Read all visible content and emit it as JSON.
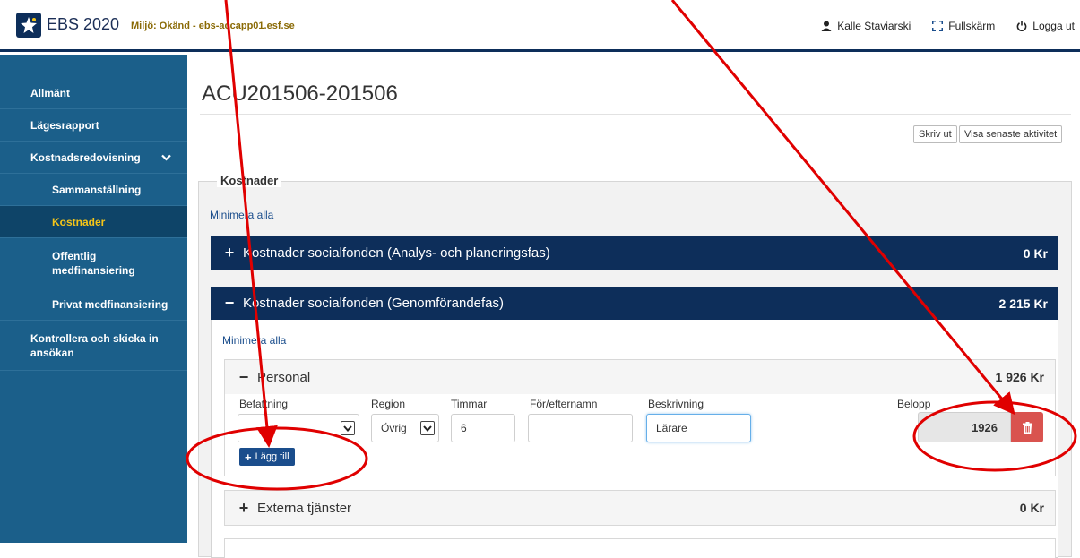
{
  "header": {
    "app_title": "EBS 2020",
    "env_label": "Miljö: Okänd - ebs-accapp01.esf.se",
    "user_name": "Kalle Staviarski",
    "fullscreen_label": "Fullskärm",
    "logout_label": "Logga ut"
  },
  "sidebar": {
    "items": [
      {
        "label": "Allmänt"
      },
      {
        "label": "Lägesrapport"
      },
      {
        "label": "Kostnadsredovisning"
      },
      {
        "label": "Sammanställning"
      },
      {
        "label": "Kostnader"
      },
      {
        "label": "Offentlig medfinansiering"
      },
      {
        "label": "Privat medfinansiering"
      },
      {
        "label": "Kontrollera och skicka in ansökan"
      }
    ]
  },
  "main": {
    "page_title": "ACU201506-201506",
    "print_label": "Skriv ut",
    "latest_activity_label": "Visa senaste aktivitet",
    "section_title": "Kostnader",
    "minimize_all_label": "Minimera alla",
    "panels": [
      {
        "title": "Kostnader socialfonden (Analys- och planeringsfas)",
        "sum": "0 Kr",
        "toggle": "+"
      },
      {
        "title": "Kostnader socialfonden (Genomförandefas)",
        "sum": "2 215 Kr",
        "toggle": "−"
      }
    ],
    "sub_panels": [
      {
        "title": "Personal",
        "sum": "1 926 Kr",
        "toggle": "−"
      },
      {
        "title": "Externa tjänster",
        "sum": "0 Kr",
        "toggle": "+"
      }
    ],
    "personal_form": {
      "labels": {
        "position": "Befattning",
        "region": "Region",
        "hours": "Timmar",
        "name": "För/efternamn",
        "description": "Beskrivning",
        "amount": "Belopp"
      },
      "values": {
        "position": "",
        "region": "Övrig",
        "hours": "6",
        "name": "",
        "description": "Lärare",
        "amount": "1926"
      },
      "add_label": "Lägg till"
    }
  },
  "colors": {
    "navy": "#0d2e5a",
    "sidebar": "#1b5f8a",
    "sidebar_active": "#0e4468",
    "active_text": "#f5c518",
    "danger": "#d9534f",
    "annotation": "#e00000"
  },
  "icons": [
    "star-logo-icon",
    "user-icon",
    "fullscreen-icon",
    "power-icon",
    "chevron-down-icon",
    "trash-icon"
  ]
}
